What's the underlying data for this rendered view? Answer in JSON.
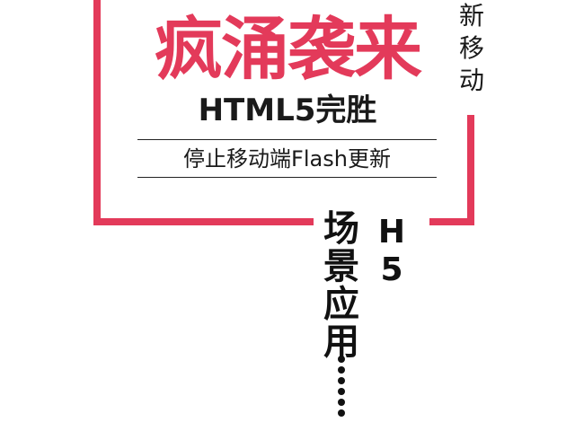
{
  "headline": "疯涌袭来",
  "subline": "HTML5完胜",
  "tagline": "停止移动端Flash更新",
  "side_note": "新\n移\n动",
  "scene_title": "场\n景\n应\n用",
  "h5_label": "H\n5",
  "ellipsis": {
    "dot_count": 6,
    "icon": "vertical-ellipsis-icon"
  },
  "colors": {
    "accent": "#e33a5a",
    "text": "#1a1a1a",
    "background": "#ffffff"
  }
}
